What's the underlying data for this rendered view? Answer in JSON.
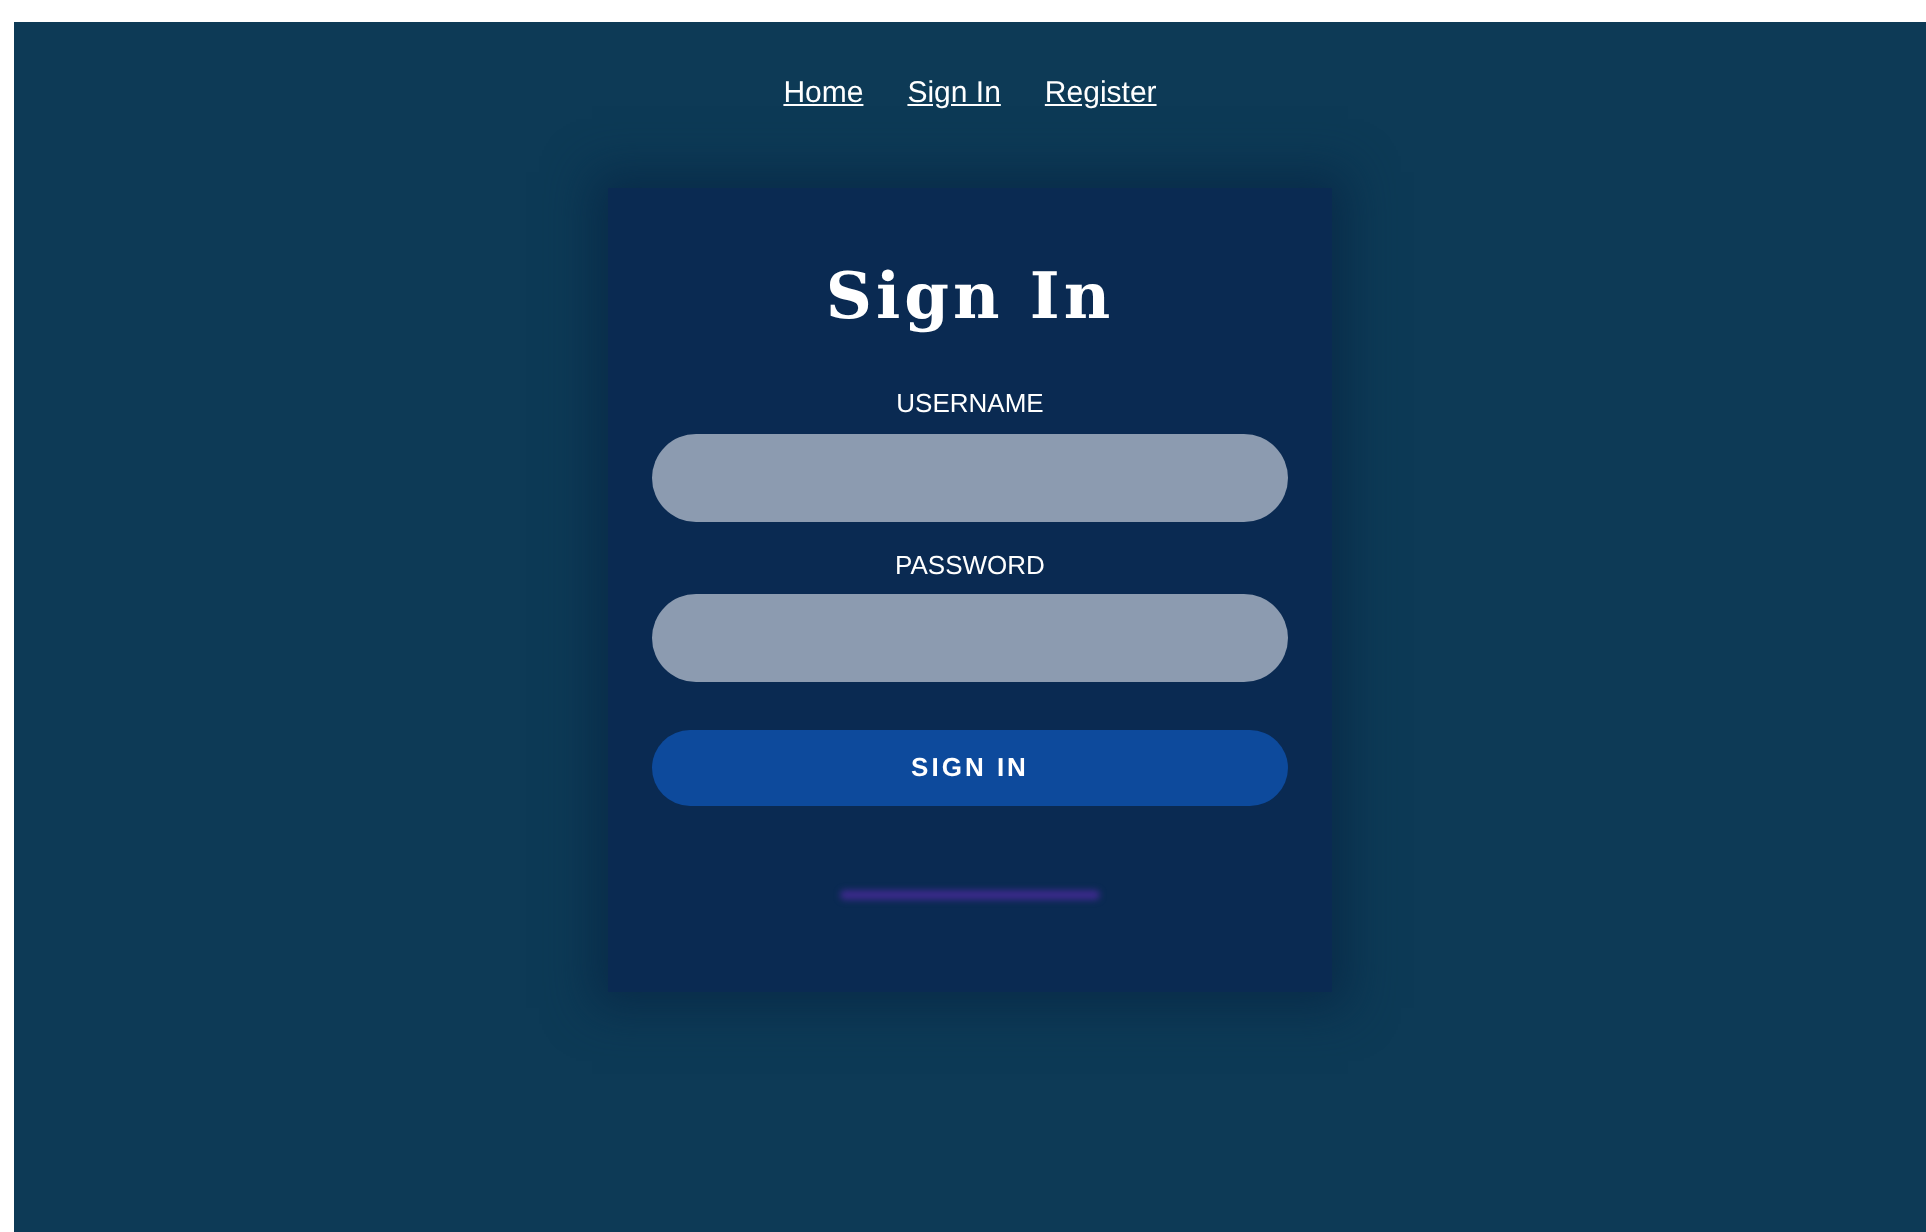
{
  "nav": {
    "links": [
      "Home",
      "Sign In",
      "Register"
    ]
  },
  "form": {
    "title": "Sign In",
    "fields": [
      {
        "label": "USERNAME"
      },
      {
        "label": "PASSWORD"
      }
    ],
    "button": "SIGN IN"
  }
}
